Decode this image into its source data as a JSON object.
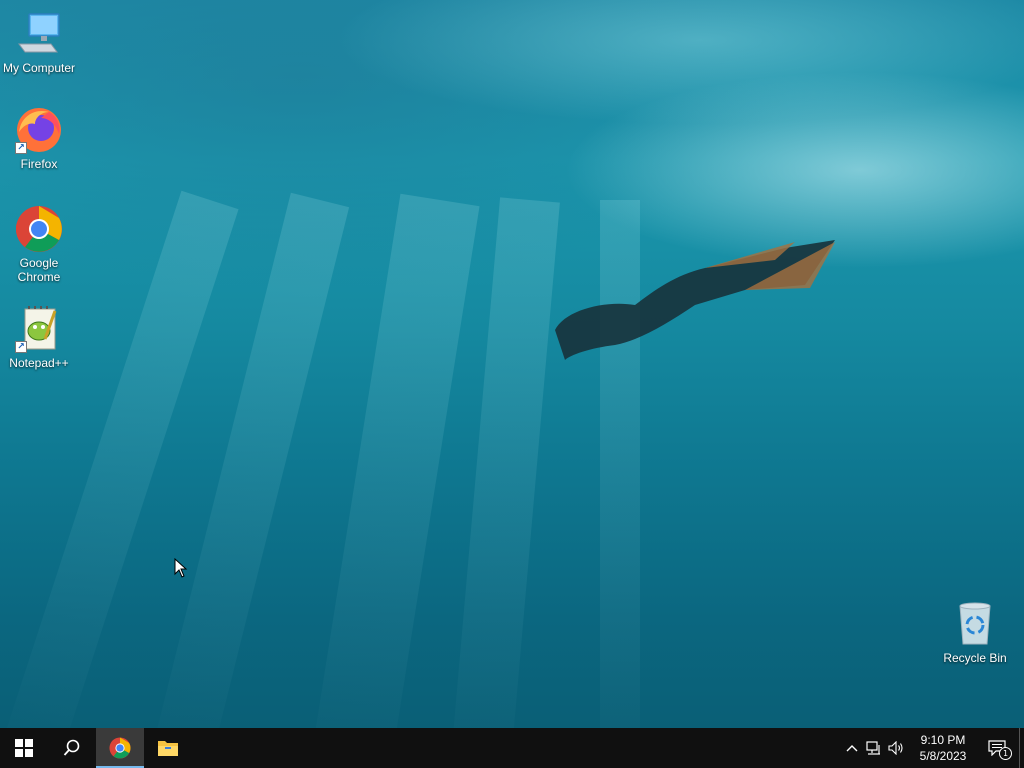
{
  "desktop": {
    "icons": [
      {
        "label": "My Computer",
        "icon": "computer-icon"
      },
      {
        "label": "Firefox",
        "icon": "firefox-icon"
      },
      {
        "label": "Google Chrome",
        "icon": "chrome-icon"
      },
      {
        "label": "Notepad++",
        "icon": "notepadpp-icon"
      },
      {
        "label": "Recycle Bin",
        "icon": "recycle-bin-icon"
      }
    ]
  },
  "taskbar": {
    "start_icon": "windows-logo-icon",
    "search_icon": "search-icon",
    "pinned": [
      {
        "name": "Google Chrome",
        "icon": "chrome-icon",
        "active": true
      },
      {
        "name": "File Explorer",
        "icon": "folder-icon",
        "active": false
      }
    ],
    "tray": {
      "chevron_icon": "chevron-up-icon",
      "network_icon": "network-icon",
      "volume_icon": "volume-icon",
      "time": "9:10 PM",
      "date": "5/8/2023",
      "notification_count": "1"
    }
  },
  "colors": {
    "taskbar_bg": "#101010",
    "active_indicator": "#76b9ed",
    "wallpaper_primary": "#1589a0"
  }
}
